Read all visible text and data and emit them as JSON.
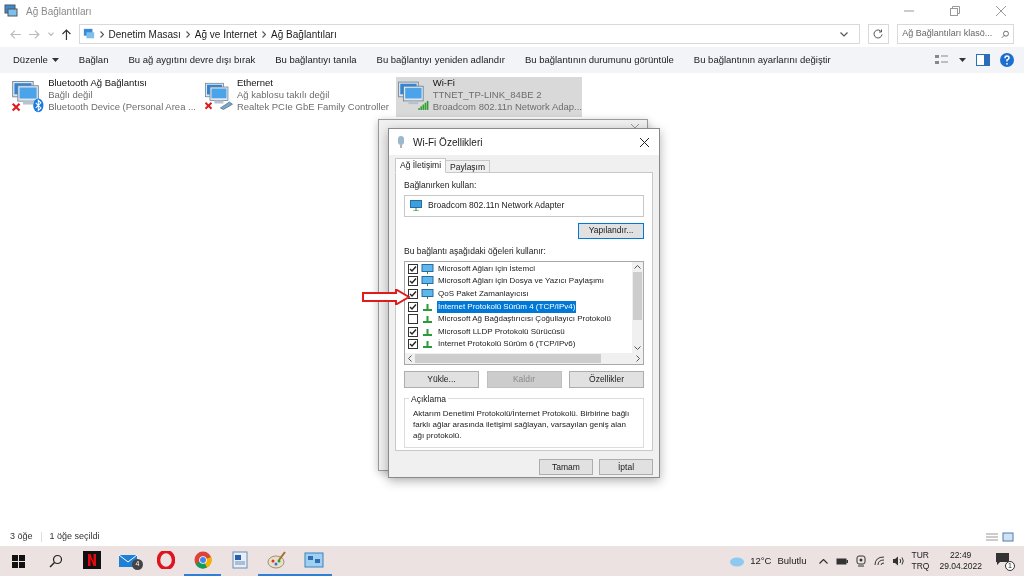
{
  "window": {
    "title": "Ağ Bağlantıları"
  },
  "address": {
    "path": [
      "Denetim Masası",
      "Ağ ve Internet",
      "Ağ Bağlantıları"
    ]
  },
  "search": {
    "placeholder": "Ağ Bağlantıları klasö..."
  },
  "toolbar": [
    {
      "label": "Düzenle",
      "kind": "menu"
    },
    {
      "label": "Bağlan",
      "kind": "command"
    },
    {
      "label": "Bu ağ aygıtını devre dışı bırak",
      "kind": "command"
    },
    {
      "label": "Bu bağlantıyı tanıla",
      "kind": "command"
    },
    {
      "label": "Bu bağlantıyı yeniden adlandır",
      "kind": "command"
    },
    {
      "label": "Bu bağlantının durumunu görüntüle",
      "kind": "command"
    },
    {
      "label": "Bu bağlantının ayarlarını değiştir",
      "kind": "command"
    }
  ],
  "connections": [
    {
      "name": "Bluetooth Ağ Bağlantısı",
      "status": "Bağlı değil",
      "device": "Bluetooth Device (Personal Area ...",
      "kind": "bluetooth",
      "disconnected": true,
      "selected": false
    },
    {
      "name": "Ethernet",
      "status": "Ağ kablosu takılı değil",
      "device": "Realtek PCIe GbE Family Controller",
      "kind": "ethernet",
      "disconnected": true,
      "selected": false
    },
    {
      "name": "Wi-Fi",
      "status": "TTNET_TP-LINK_84BE 2",
      "device": "Broadcom 802.11n Network Adap...",
      "kind": "wifi",
      "disconnected": false,
      "selected": true
    }
  ],
  "dialog": {
    "title": "Wi-Fi Özellikleri",
    "tabs": [
      {
        "label": "Ağ İletişimi",
        "selected": true
      },
      {
        "label": "Paylaşım",
        "selected": false
      }
    ],
    "connect_using_label": "Bağlanırken kullan:",
    "adapter": "Broadcom 802.11n Network Adapter",
    "configure_button": "Yapılandır...",
    "items_label": "Bu bağlantı aşağıdaki öğeleri kullanır:",
    "items": [
      {
        "label": "Microsoft Ağları için İstemci",
        "checked": true,
        "selected": false,
        "kind": "client"
      },
      {
        "label": "Microsoft Ağları için Dosya ve Yazıcı Paylaşımı",
        "checked": true,
        "selected": false,
        "kind": "client"
      },
      {
        "label": "QoS Paket Zamanlayıcısı",
        "checked": true,
        "selected": false,
        "kind": "client"
      },
      {
        "label": "İnternet Protokolü Sürüm 4 (TCP/IPv4)",
        "checked": true,
        "selected": true,
        "kind": "protocol"
      },
      {
        "label": "Microsoft Ağ Bağdaştırıcısı Çoğullayıcı Protokolü",
        "checked": false,
        "selected": false,
        "kind": "protocol"
      },
      {
        "label": "Microsoft LLDP Protokolü Sürücüsü",
        "checked": true,
        "selected": false,
        "kind": "protocol"
      },
      {
        "label": "İnternet Protokolü Sürüm 6 (TCP/IPv6)",
        "checked": true,
        "selected": false,
        "kind": "protocol"
      }
    ],
    "buttons": [
      {
        "label": "Yükle...",
        "disabled": false
      },
      {
        "label": "Kaldır",
        "disabled": true
      },
      {
        "label": "Özellikler",
        "disabled": false
      }
    ],
    "description_title": "Açıklama",
    "description": "Aktarım Denetimi Protokolü/İnternet Protokolü. Birbirine bağlı farklı ağlar arasında iletişimi sağlayan, varsayılan geniş alan ağı protokolü.",
    "footer_buttons": [
      "Tamam",
      "İptal"
    ]
  },
  "status_bar": {
    "count": "3 öğe",
    "selection": "1 öğe seçildi"
  },
  "taskbar": {
    "apps": [
      {
        "kind": "netflix",
        "running": false
      },
      {
        "kind": "mail",
        "running": false,
        "badge": "4"
      },
      {
        "kind": "opera",
        "running": false
      },
      {
        "kind": "chrome",
        "running": true
      },
      {
        "kind": "document",
        "running": false
      },
      {
        "kind": "paint",
        "running": true
      },
      {
        "kind": "network",
        "running": true
      }
    ],
    "weather": "12°C",
    "weather_text": "Bulutlu",
    "language": [
      "TUR",
      "TRQ"
    ],
    "time": "22:49",
    "date": "29.04.2022",
    "notifications": "1"
  }
}
